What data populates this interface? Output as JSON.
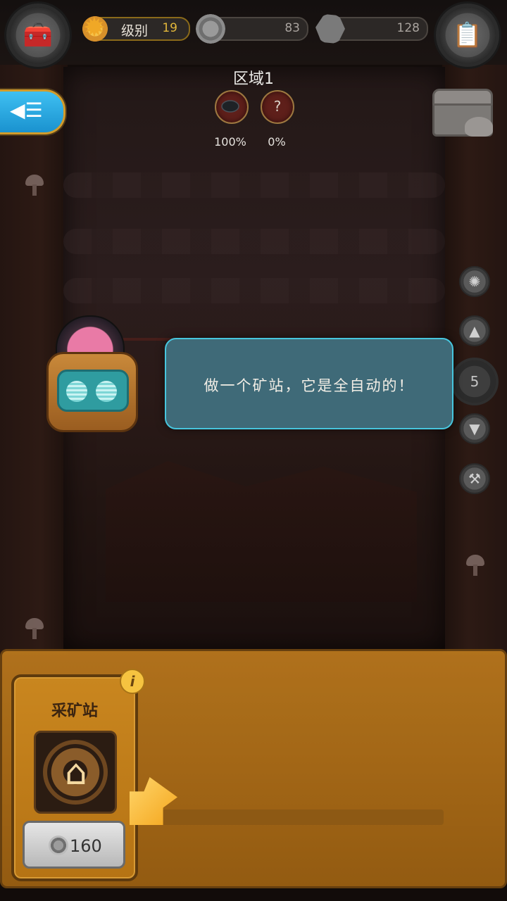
{
  "topbar": {
    "level_label": "级别",
    "level_value": "19",
    "coins_value": "83",
    "stone_value": "128",
    "left_button_icon": "toolbox-icon",
    "right_button_icon": "clipboard-icon"
  },
  "zone": {
    "title": "区域1",
    "ores": [
      {
        "icon": "coal-ore-icon",
        "glyph": "",
        "percent": "100%"
      },
      {
        "icon": "unknown-ore-icon",
        "glyph": "?",
        "percent": "0%"
      }
    ]
  },
  "back_button": {
    "glyph": "◀☰"
  },
  "side_controls": {
    "depth_value": "5",
    "icons": [
      "sun-icon",
      "up-arrow-icon",
      "down-arrow-icon",
      "pickaxe-icon"
    ]
  },
  "dialog": {
    "text": "做一个矿站，它是全自动的！"
  },
  "build_panel": {
    "card_title": "采矿站",
    "info_glyph": "i",
    "cost": "160"
  },
  "colors": {
    "accent_blue": "#3fc0f2",
    "panel_orange": "#b7761d",
    "speech_bg": "#3f6a78",
    "level_gold": "#e2b73a"
  }
}
